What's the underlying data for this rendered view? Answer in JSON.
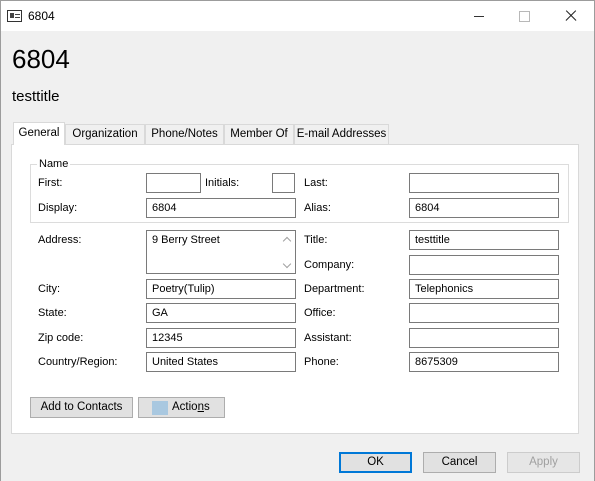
{
  "window": {
    "title": "6804",
    "icons": {
      "app": "address-card-icon",
      "minimize": "minimize-icon",
      "maximize": "maximize-icon",
      "close": "close-icon"
    }
  },
  "header": {
    "name": "6804",
    "title": "testtitle"
  },
  "tabs": [
    {
      "label": "General",
      "active": true
    },
    {
      "label": "Organization"
    },
    {
      "label": "Phone/Notes"
    },
    {
      "label": "Member Of"
    },
    {
      "label": "E-mail Addresses"
    }
  ],
  "name_group": {
    "label": "Name",
    "first": {
      "label": "First:",
      "value": ""
    },
    "initials": {
      "label": "Initials:",
      "value": ""
    },
    "last": {
      "label": "Last:",
      "value": ""
    },
    "display": {
      "label": "Display:",
      "value": "6804"
    },
    "alias": {
      "label": "Alias:",
      "value": "6804"
    }
  },
  "details": {
    "address": {
      "label": "Address:",
      "value": "9 Berry Street"
    },
    "title": {
      "label": "Title:",
      "value": "testtitle"
    },
    "company": {
      "label": "Company:",
      "value": ""
    },
    "city": {
      "label": "City:",
      "value": "Poetry(Tulip)"
    },
    "department": {
      "label": "Department:",
      "value": "Telephonics"
    },
    "state": {
      "label": "State:",
      "value": "GA"
    },
    "office": {
      "label": "Office:",
      "value": ""
    },
    "zip": {
      "label": "Zip code:",
      "value": "12345"
    },
    "assistant": {
      "label": "Assistant:",
      "value": ""
    },
    "country": {
      "label": "Country/Region:",
      "value": "United States"
    },
    "phone": {
      "label": "Phone:",
      "value": "8675309"
    }
  },
  "panel_buttons": {
    "add_to_contacts": "Add to Contacts",
    "actions_pre": "Actio",
    "actions_ul": "n",
    "actions_post": "s"
  },
  "footer": {
    "ok": "OK",
    "cancel": "Cancel",
    "apply": "Apply"
  },
  "colors": {
    "accent": "#0078d7",
    "actions_swatch": "#a9c8e0"
  }
}
